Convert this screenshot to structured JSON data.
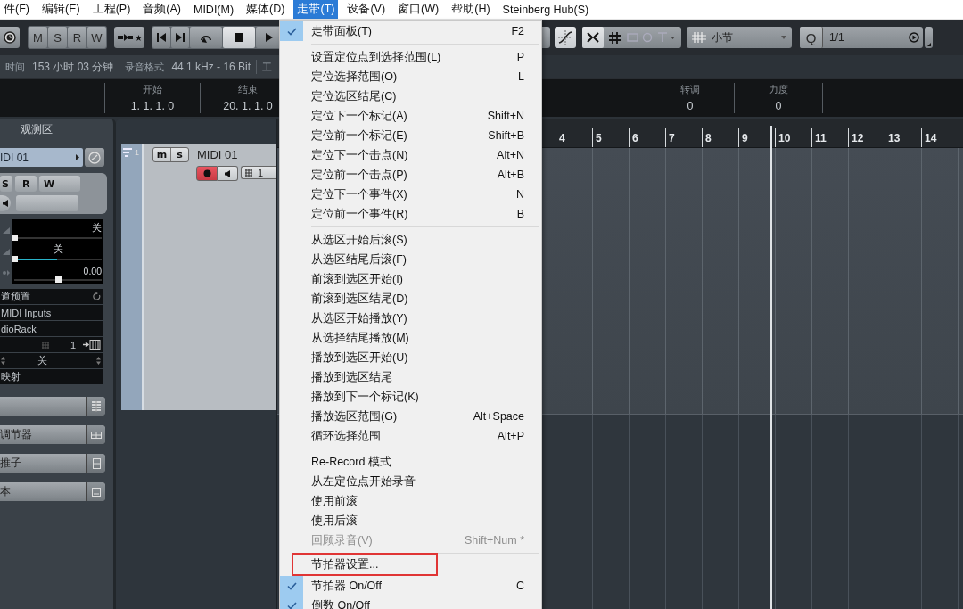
{
  "menubar": [
    {
      "label": "件(F)",
      "selected": false
    },
    {
      "label": "编辑(E)",
      "selected": false
    },
    {
      "label": "工程(P)",
      "selected": false
    },
    {
      "label": "音频(A)",
      "selected": false
    },
    {
      "label": "MIDI(M)",
      "selected": false
    },
    {
      "label": "媒体(D)",
      "selected": false
    },
    {
      "label": "走带(T)",
      "selected": true
    },
    {
      "label": "设备(V)",
      "selected": false
    },
    {
      "label": "窗口(W)",
      "selected": false
    },
    {
      "label": "帮助(H)",
      "selected": false
    },
    {
      "label": "Steinberg Hub(S)",
      "selected": false
    }
  ],
  "toolbar": {
    "mode_buttons": [
      "M",
      "S",
      "R",
      "W"
    ],
    "snap_type": {
      "value": "小节"
    },
    "quantize": {
      "label": "Q",
      "value": "1/1"
    }
  },
  "status_line": [
    {
      "label": "时间",
      "value": "153 小时 03 分钟"
    },
    {
      "label": "录音格式",
      "value": "44.1 kHz - 16 Bit"
    },
    {
      "label": "工"
    }
  ],
  "info_line": {
    "left_fields": [
      {
        "label": "开始",
        "value": "1. 1. 1. 0"
      },
      {
        "label": "结束",
        "value": "20. 1. 1. 0"
      }
    ],
    "right_fields": [
      {
        "label": "转调",
        "value": "0"
      },
      {
        "label": "力度",
        "value": "0"
      }
    ]
  },
  "inspector": {
    "title": "观测区",
    "track_name": "IDI 01",
    "buttons": [
      "S",
      "R",
      "W"
    ],
    "volume": {
      "value": "关",
      "level": 0
    },
    "pan": {
      "value": "关",
      "level": 0.49
    },
    "delay": {
      "value": "0.00",
      "level": 0.5
    },
    "preset": "道预置",
    "input": "MIDI Inputs",
    "output": "dioRack",
    "channel": "1",
    "bank": "关",
    "map": "映射",
    "sections": [
      "调节器",
      "推子",
      "本"
    ]
  },
  "track": {
    "number": "1",
    "mute": "m",
    "solo": "s",
    "name": "MIDI 01",
    "channel": "1",
    "record_enabled": true
  },
  "ruler": {
    "bars": [
      "4",
      "5",
      "6",
      "7",
      "8",
      "9",
      "10",
      "11",
      "12",
      "13",
      "14"
    ]
  },
  "menu": {
    "items": [
      {
        "kind": "item",
        "label": "走带面板(T)",
        "shortcut": "F2",
        "checked": true,
        "disabled": false,
        "highlighted": false
      },
      {
        "kind": "separator"
      },
      {
        "kind": "item",
        "label": "设置定位点到选择范围(L)",
        "shortcut": "P",
        "checked": false,
        "disabled": false,
        "highlighted": false
      },
      {
        "kind": "item",
        "label": "定位选择范围(O)",
        "shortcut": "L",
        "checked": false,
        "disabled": false,
        "highlighted": false
      },
      {
        "kind": "item",
        "label": "定位选区结尾(C)",
        "checked": false,
        "disabled": false,
        "highlighted": false
      },
      {
        "kind": "item",
        "label": "定位下一个标记(A)",
        "shortcut": "Shift+N",
        "checked": false,
        "disabled": false,
        "highlighted": false
      },
      {
        "kind": "item",
        "label": "定位前一个标记(E)",
        "shortcut": "Shift+B",
        "checked": false,
        "disabled": false,
        "highlighted": false
      },
      {
        "kind": "item",
        "label": "定位下一个击点(N)",
        "shortcut": "Alt+N",
        "checked": false,
        "disabled": false,
        "highlighted": false
      },
      {
        "kind": "item",
        "label": "定位前一个击点(P)",
        "shortcut": "Alt+B",
        "checked": false,
        "disabled": false,
        "highlighted": false
      },
      {
        "kind": "item",
        "label": "定位下一个事件(X)",
        "shortcut": "N",
        "checked": false,
        "disabled": false,
        "highlighted": false
      },
      {
        "kind": "item",
        "label": "定位前一个事件(R)",
        "shortcut": "B",
        "checked": false,
        "disabled": false,
        "highlighted": false
      },
      {
        "kind": "separator"
      },
      {
        "kind": "item",
        "label": "从选区开始后滚(S)",
        "checked": false,
        "disabled": false,
        "highlighted": false
      },
      {
        "kind": "item",
        "label": "从选区结尾后滚(F)",
        "checked": false,
        "disabled": false,
        "highlighted": false
      },
      {
        "kind": "item",
        "label": "前滚到选区开始(I)",
        "checked": false,
        "disabled": false,
        "highlighted": false
      },
      {
        "kind": "item",
        "label": "前滚到选区结尾(D)",
        "checked": false,
        "disabled": false,
        "highlighted": false
      },
      {
        "kind": "item",
        "label": "从选区开始播放(Y)",
        "checked": false,
        "disabled": false,
        "highlighted": false
      },
      {
        "kind": "item",
        "label": "从选择结尾播放(M)",
        "checked": false,
        "disabled": false,
        "highlighted": false
      },
      {
        "kind": "item",
        "label": "播放到选区开始(U)",
        "checked": false,
        "disabled": false,
        "highlighted": false
      },
      {
        "kind": "item",
        "label": "播放到选区结尾",
        "checked": false,
        "disabled": false,
        "highlighted": false
      },
      {
        "kind": "item",
        "label": "播放到下一个标记(K)",
        "checked": false,
        "disabled": false,
        "highlighted": false
      },
      {
        "kind": "item",
        "label": "播放选区范围(G)",
        "shortcut": "Alt+Space",
        "checked": false,
        "disabled": false,
        "highlighted": false
      },
      {
        "kind": "item",
        "label": "循环选择范围",
        "shortcut": "Alt+P",
        "checked": false,
        "disabled": false,
        "highlighted": false
      },
      {
        "kind": "separator"
      },
      {
        "kind": "item",
        "label": "Re-Record 模式",
        "checked": false,
        "disabled": false,
        "highlighted": false
      },
      {
        "kind": "item",
        "label": "从左定位点开始录音",
        "checked": false,
        "disabled": false,
        "highlighted": false
      },
      {
        "kind": "item",
        "label": "使用前滚",
        "checked": false,
        "disabled": false,
        "highlighted": false
      },
      {
        "kind": "item",
        "label": "使用后滚",
        "checked": false,
        "disabled": false,
        "highlighted": false
      },
      {
        "kind": "item",
        "label": "回顾录音(V)",
        "shortcut": "Shift+Num *",
        "checked": false,
        "disabled": true,
        "highlighted": false
      },
      {
        "kind": "separator"
      },
      {
        "kind": "item",
        "label": "节拍器设置...",
        "checked": false,
        "disabled": false,
        "highlighted": true
      },
      {
        "kind": "item",
        "label": "节拍器 On/Off",
        "shortcut": "C",
        "checked": true,
        "disabled": false,
        "highlighted": false
      },
      {
        "kind": "item",
        "label": "倒数 On/Off",
        "checked": true,
        "disabled": false,
        "highlighted": false
      }
    ]
  }
}
